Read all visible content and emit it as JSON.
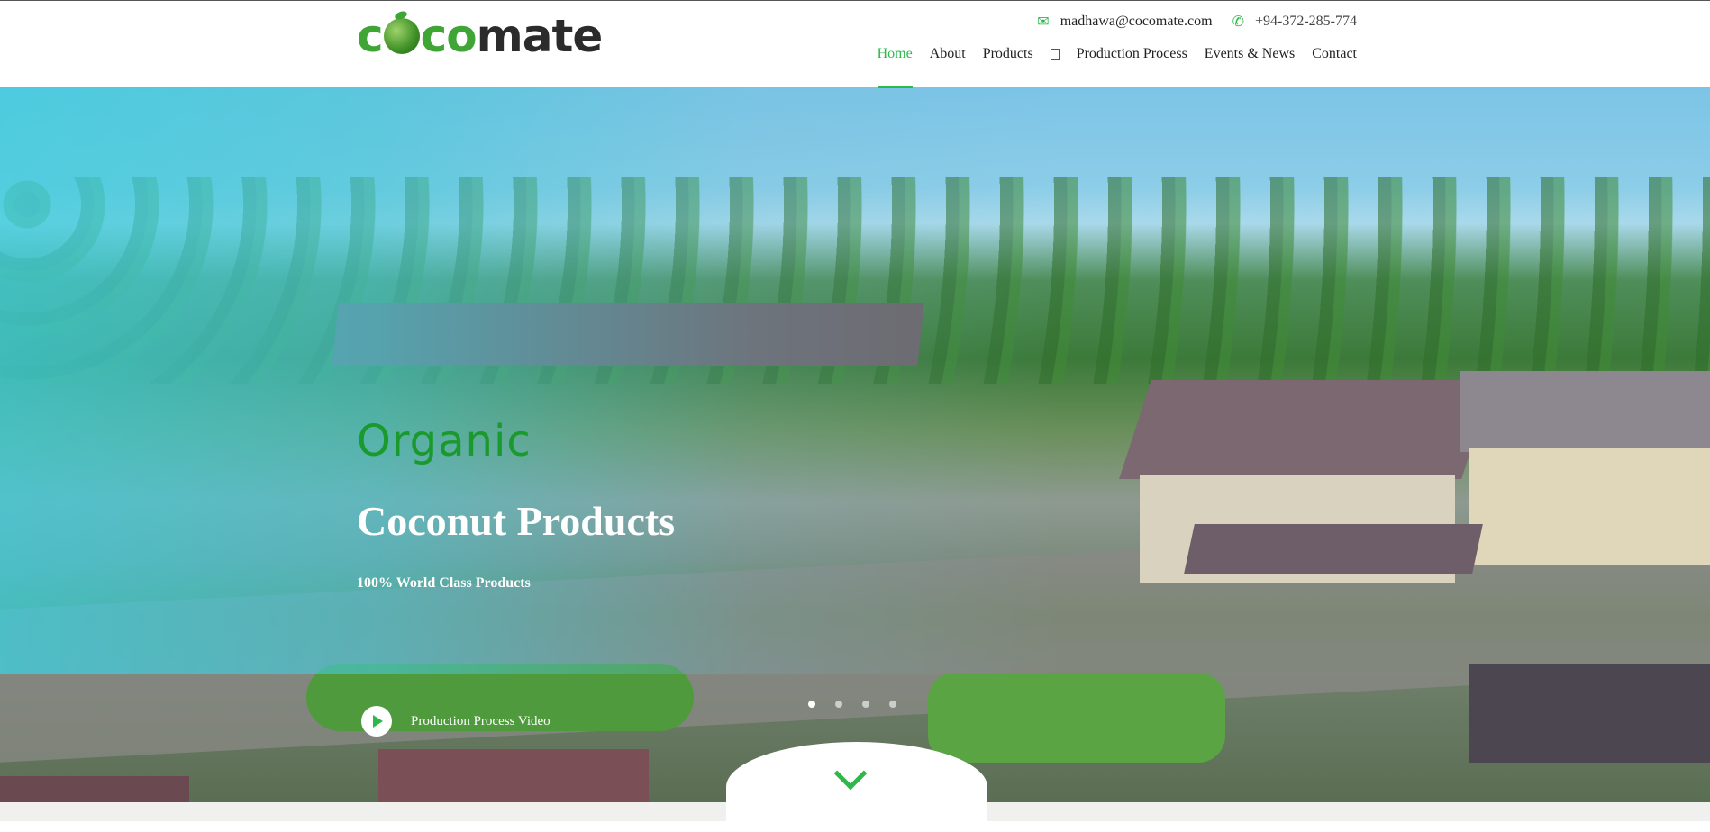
{
  "brand": {
    "logo_part1": "coco",
    "logo_part2": "mate",
    "colors": {
      "accent": "#2eb84b",
      "dark": "#2b2b2b"
    }
  },
  "topbar": {
    "email": "madhawa@cocomate.com",
    "phone": "+94-372-285-774",
    "email_icon": "envelope-icon",
    "phone_icon": "phone-icon"
  },
  "nav": {
    "items": [
      {
        "label": "Home",
        "active": true
      },
      {
        "label": "About"
      },
      {
        "label": "Products"
      },
      {
        "label": "Production Process"
      },
      {
        "label": "Events & News"
      },
      {
        "label": "Contact"
      }
    ],
    "cart_icon": "cart-icon"
  },
  "hero": {
    "eyebrow": "Organic",
    "title": "Coconut Products",
    "subtitle": "100% World Class Products",
    "video_label": "Production Process Video",
    "slides_total": 4,
    "active_slide": 1
  }
}
